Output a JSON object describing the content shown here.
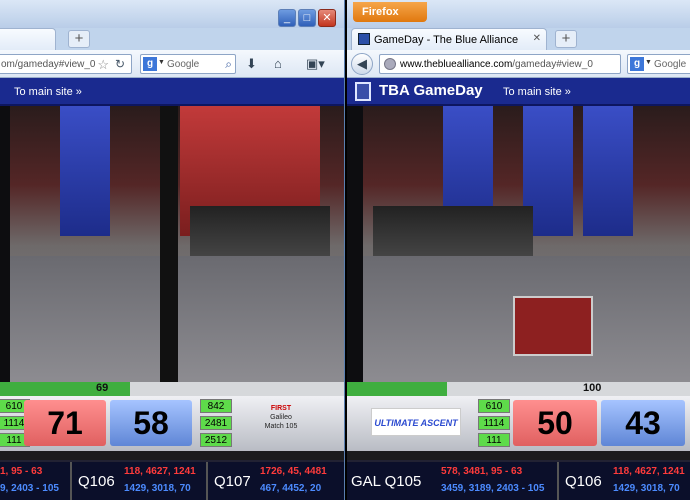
{
  "left_window": {
    "tab_new_symbol": "+",
    "window_controls": [
      "_",
      "□",
      "✕"
    ],
    "url_partial": "om/gameday#view_0",
    "search_engine": "Google",
    "search_placeholder": "Google",
    "main_link": "To main site »",
    "timer": "69",
    "red_teams": [
      "610",
      "1114",
      "111"
    ],
    "red_score": "71",
    "blue_score": "58",
    "blue_teams": [
      "842",
      "2481",
      "2512"
    ],
    "match_label_1": "FIRST",
    "match_label_2": "Galileo",
    "match_label_3": "Match 105",
    "ticker": [
      {
        "label": "",
        "red": "1, 95 - 63",
        "blue": "9, 2403 - 105"
      },
      {
        "label": "Q106",
        "red": "118, 4627, 1241",
        "blue": "1429, 3018, 70"
      },
      {
        "label": "Q107",
        "red": "1726, 45, 4481",
        "blue": "467, 4452, 20"
      }
    ]
  },
  "right_window": {
    "firefox_label": "Firefox",
    "tab_title": "GameDay - The Blue Alliance",
    "tab_new_symbol": "+",
    "url_host": "www.thebluealliance.com",
    "url_rest": "/gameday#view_0",
    "search_placeholder": "Google",
    "site_title": "TBA GameDay",
    "main_link": "To main site »",
    "timer": "100",
    "red_teams": [
      "610",
      "1114",
      "111"
    ],
    "red_score": "50",
    "blue_score": "43",
    "game_logo_text": "ULTIMATE ASCENT",
    "ticker": [
      {
        "label": "GAL Q105",
        "red": "578, 3481, 95 - 63",
        "blue": "3459, 3189, 2403 - 105"
      },
      {
        "label": "Q106",
        "red": "118, 4627, 1241",
        "blue": "1429, 3018, 70"
      }
    ]
  },
  "colors": {
    "site_header": "#1a2a8f",
    "red_score_text": "#ff3b3b",
    "blue_score_text": "#4c8bff",
    "firefox_orange": "#e0780e"
  },
  "icons": [
    "plus-icon",
    "bookmark-star-icon",
    "reload-icon",
    "google-icon",
    "search-icon",
    "download-icon",
    "home-icon",
    "bookmarks-menu-icon",
    "back-icon",
    "site-favicon",
    "tba-logo-icon"
  ]
}
